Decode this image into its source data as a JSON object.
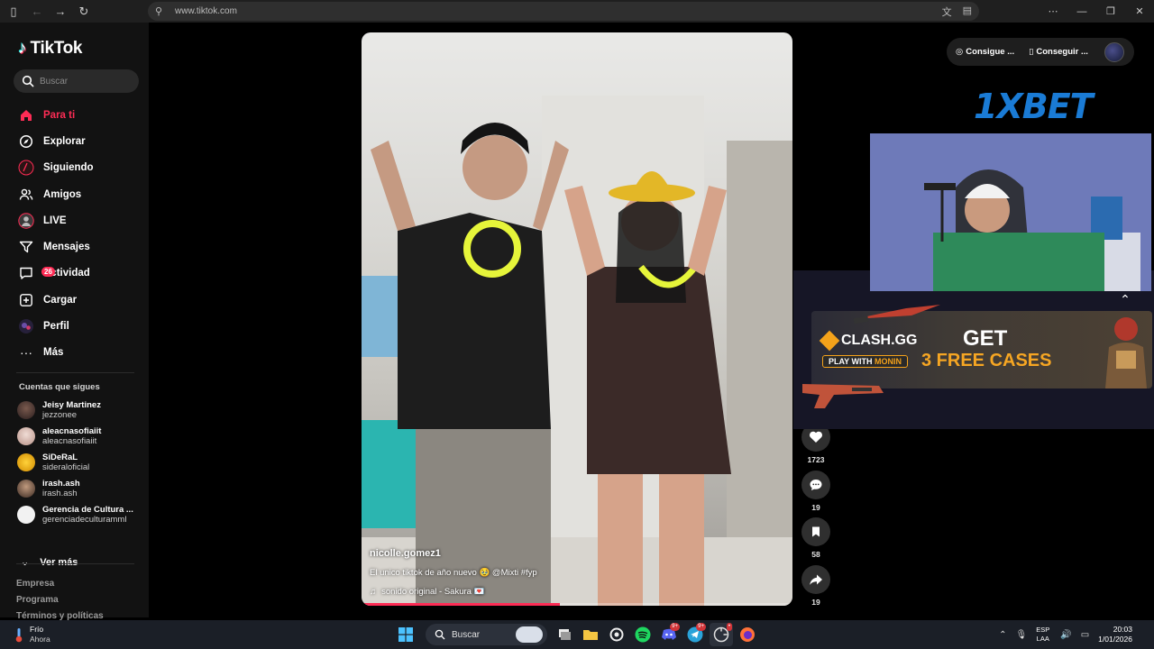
{
  "browser": {
    "url": "www.tiktok.com"
  },
  "sidebar": {
    "brand": "TikTok",
    "search_placeholder": "Buscar",
    "menu": [
      {
        "label": "Para ti",
        "icon": "home-icon",
        "active": true
      },
      {
        "label": "Explorar",
        "icon": "compass-icon"
      },
      {
        "label": "Siguiendo",
        "icon": "following-icon"
      },
      {
        "label": "Amigos",
        "icon": "friends-icon"
      },
      {
        "label": "LIVE",
        "icon": "live-icon"
      },
      {
        "label": "Mensajes",
        "icon": "messages-icon"
      },
      {
        "label": "Actividad",
        "icon": "activity-icon",
        "badge": "26"
      },
      {
        "label": "Cargar",
        "icon": "upload-icon"
      },
      {
        "label": "Perfil",
        "icon": "profile-icon"
      },
      {
        "label": "Más",
        "icon": "more-icon"
      }
    ],
    "following_title": "Cuentas que sigues",
    "following": [
      {
        "name": "Jeisy Martinez",
        "handle": "jezzonee"
      },
      {
        "name": "aleacnasofiaiit",
        "handle": "aleacnasofiaiit"
      },
      {
        "name": "SiDeRaL",
        "handle": "sideraloficial"
      },
      {
        "name": "irash.ash",
        "handle": "irash.ash"
      },
      {
        "name": "Gerencia de Cultura ...",
        "handle": "gerenciadeculturamml"
      }
    ],
    "see_more": "Ver más",
    "footer": [
      "Empresa",
      "Programa",
      "Términos y políticas"
    ]
  },
  "video": {
    "username": "nicolle.gomez1",
    "caption": "El unico tiktok de año nuevo 🥹 @Mixti #fyp",
    "music": "sonido original - Sakura 💌",
    "progress": 0.46
  },
  "actions": [
    {
      "name": "like",
      "icon": "heart-icon",
      "count": "1723"
    },
    {
      "name": "comment",
      "icon": "comment-icon",
      "count": "19"
    },
    {
      "name": "save",
      "icon": "bookmark-icon",
      "count": "58"
    },
    {
      "name": "share",
      "icon": "share-icon",
      "count": "19"
    }
  ],
  "topright": {
    "coins_label": "Consigue ...",
    "app_label": "Conseguir ..."
  },
  "overlay": {
    "sponsor": "1XBET",
    "clash_brand": "CLASH.GG",
    "clash_playwith": "PLAY WITH",
    "clash_code": "MONIN",
    "clash_get": "GET",
    "clash_free": "3 FREE CASES"
  },
  "taskbar": {
    "weather_title": "Frío",
    "weather_sub": "Ahora",
    "search_placeholder": "Buscar",
    "lang_1": "ESP",
    "lang_2": "LAA",
    "time": "20:03",
    "date": "1/01/2026"
  },
  "colors": {
    "accent": "#fe2c55",
    "sidebar_bg": "#121212"
  }
}
